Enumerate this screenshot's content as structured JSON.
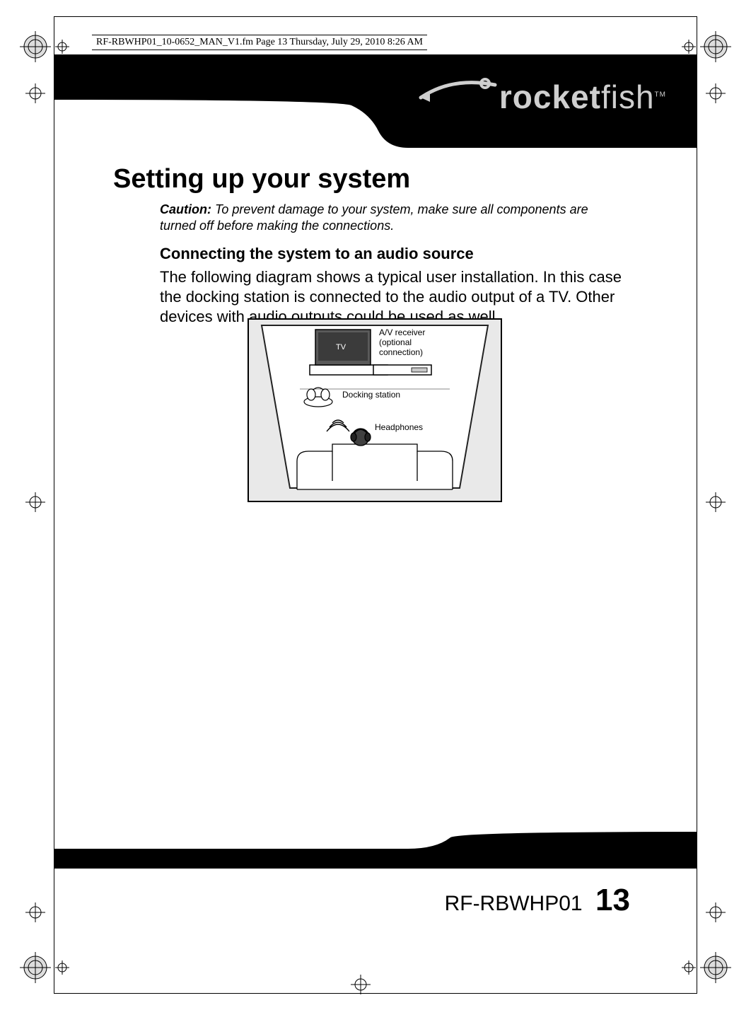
{
  "running_head": "RF-RBWHP01_10-0652_MAN_V1.fm  Page 13  Thursday, July 29, 2010  8:26 AM",
  "brand": {
    "part1": "rocket",
    "part2": "fish",
    "tm": "TM"
  },
  "h1": "Setting up your system",
  "caution_label": "Caution:",
  "caution_text": " To prevent damage to your system, make sure all components are turned off before making the connections.",
  "h2": "Connecting the system to an audio source",
  "body": "The following diagram shows a typical user installation. In this case the docking station is connected to the audio output of a TV. Other devices with audio outputs could be used as well.",
  "diagram": {
    "tv": "TV",
    "av1": "A/V receiver",
    "av2": "(optional",
    "av3": "connection)",
    "dock": "Docking station",
    "headphones": "Headphones"
  },
  "footer": {
    "model": "RF-RBWHP01",
    "page": "13"
  }
}
